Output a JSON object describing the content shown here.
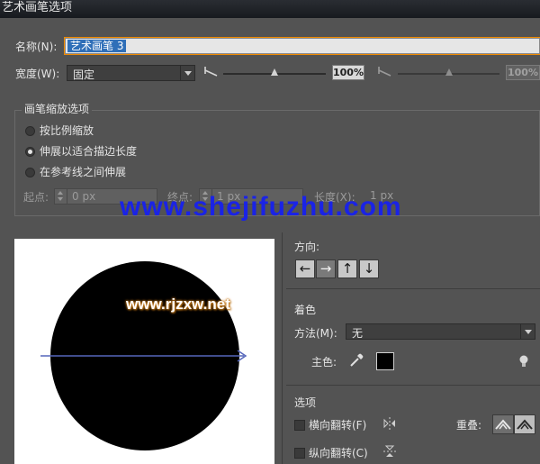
{
  "window": {
    "title": "艺术画笔选项"
  },
  "name": {
    "label": "名称(N):",
    "value": "艺术画笔 3"
  },
  "width": {
    "label": "宽度(W):",
    "mode": "固定",
    "slider1_value": "100%",
    "slider2_value": "100%",
    "slider1_level": 0.5,
    "slider2_level": 0.5
  },
  "scale": {
    "group_title": "画笔缩放选项",
    "options": [
      "按比例缩放",
      "伸展以适合描边长度",
      "在参考线之间伸展"
    ],
    "selected_index": 1,
    "start_label": "起点:",
    "start_value": "0 px",
    "end_label": "终点:",
    "end_value": "1 px",
    "length_label": "长度(X):",
    "length_value": "1 px"
  },
  "watermarks": {
    "top": "www.shejifuzhu.com",
    "preview": "www.rjzxw.net"
  },
  "direction": {
    "title": "方向:",
    "buttons": [
      "←",
      "→",
      "↑",
      "↓"
    ],
    "active_index": 1
  },
  "colorize": {
    "title": "着色",
    "method_label": "方法(M):",
    "method_value": "无",
    "key_color_label": "主色:",
    "key_color": "#000000",
    "icons": [
      "eyedropper-icon",
      "tips-lightbulb-icon"
    ]
  },
  "options": {
    "title": "选项",
    "flip_along_label": "横向翻转(F)",
    "flip_across_label": "纵向翻转(C)",
    "overlap_label": "重叠:"
  },
  "colors": {
    "accent_focus": "#f08a00",
    "selection": "#2f6fb8",
    "watermark_blue": "#1a23e6",
    "guide_line": "#5566bb"
  }
}
